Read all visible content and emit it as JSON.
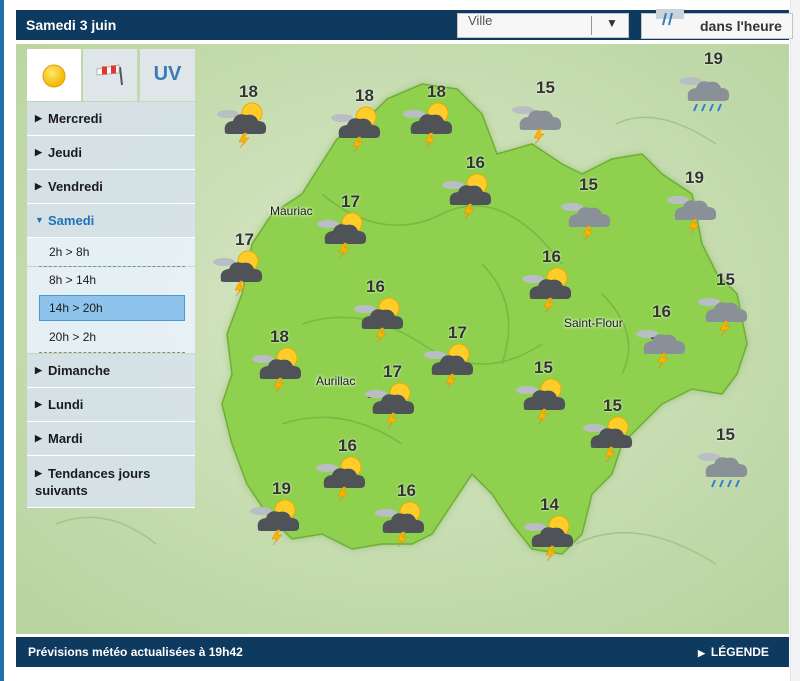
{
  "header": {
    "date": "Samedi 3 juin"
  },
  "city_select": {
    "value": "Ville"
  },
  "hour_button": {
    "label": "dans l'heure"
  },
  "tabs": [
    {
      "name": "sun-tab",
      "icon": "sun-icon",
      "active": true
    },
    {
      "name": "wind-tab",
      "icon": "windsock-icon",
      "active": false
    },
    {
      "name": "uv-tab",
      "label": "UV",
      "active": false
    }
  ],
  "days": {
    "mercredi": "Mercredi",
    "jeudi": "Jeudi",
    "vendredi": "Vendredi",
    "samedi": "Samedi",
    "dimanche": "Dimanche",
    "lundi": "Lundi",
    "mardi": "Mardi",
    "tendances": "Tendances jours suivants"
  },
  "time_slots": {
    "s1": "2h > 8h",
    "s2": "8h > 14h",
    "s3": "14h > 20h",
    "s4": "20h > 2h",
    "selected": "14h > 20h"
  },
  "towns": {
    "mauriac": "Mauriac",
    "aurillac": "Aurillac",
    "saint_flour": "Saint-Flour"
  },
  "forecasts": [
    {
      "temp": "18",
      "icon": "sun-cloud-storm-icon"
    },
    {
      "temp": "18",
      "icon": "sun-cloud-storm-icon"
    },
    {
      "temp": "18",
      "icon": "sun-cloud-storm-icon"
    },
    {
      "temp": "15",
      "icon": "cloud-storm-icon"
    },
    {
      "temp": "19",
      "icon": "cloud-rain-icon"
    },
    {
      "temp": "16",
      "icon": "sun-cloud-storm-icon"
    },
    {
      "temp": "17",
      "icon": "sun-cloud-storm-icon"
    },
    {
      "temp": "15",
      "icon": "cloud-storm-icon"
    },
    {
      "temp": "19",
      "icon": "cloud-storm-icon"
    },
    {
      "temp": "17",
      "icon": "sun-cloud-storm-icon"
    },
    {
      "temp": "16",
      "icon": "sun-cloud-storm-icon"
    },
    {
      "temp": "16",
      "icon": "sun-cloud-storm-icon"
    },
    {
      "temp": "15",
      "icon": "cloud-storm-icon"
    },
    {
      "temp": "16",
      "icon": "cloud-storm-icon"
    },
    {
      "temp": "18",
      "icon": "sun-cloud-storm-icon"
    },
    {
      "temp": "17",
      "icon": "sun-cloud-storm-icon"
    },
    {
      "temp": "17",
      "icon": "sun-cloud-storm-icon"
    },
    {
      "temp": "15",
      "icon": "sun-cloud-storm-icon"
    },
    {
      "temp": "15",
      "icon": "sun-cloud-storm-icon"
    },
    {
      "temp": "15",
      "icon": "cloud-rain-icon"
    },
    {
      "temp": "16",
      "icon": "sun-cloud-storm-icon"
    },
    {
      "temp": "19",
      "icon": "sun-cloud-storm-icon"
    },
    {
      "temp": "16",
      "icon": "sun-cloud-storm-icon"
    },
    {
      "temp": "14",
      "icon": "sun-cloud-storm-icon"
    }
  ],
  "footer": {
    "text": "Prévisions météo actualisées à 19h42",
    "legend": "LÉGENDE"
  },
  "colors": {
    "header": "#0e3a60",
    "map_green": "#8fd14f",
    "selected_slot": "#8ec4ec",
    "accent_link": "#1f72b9"
  }
}
